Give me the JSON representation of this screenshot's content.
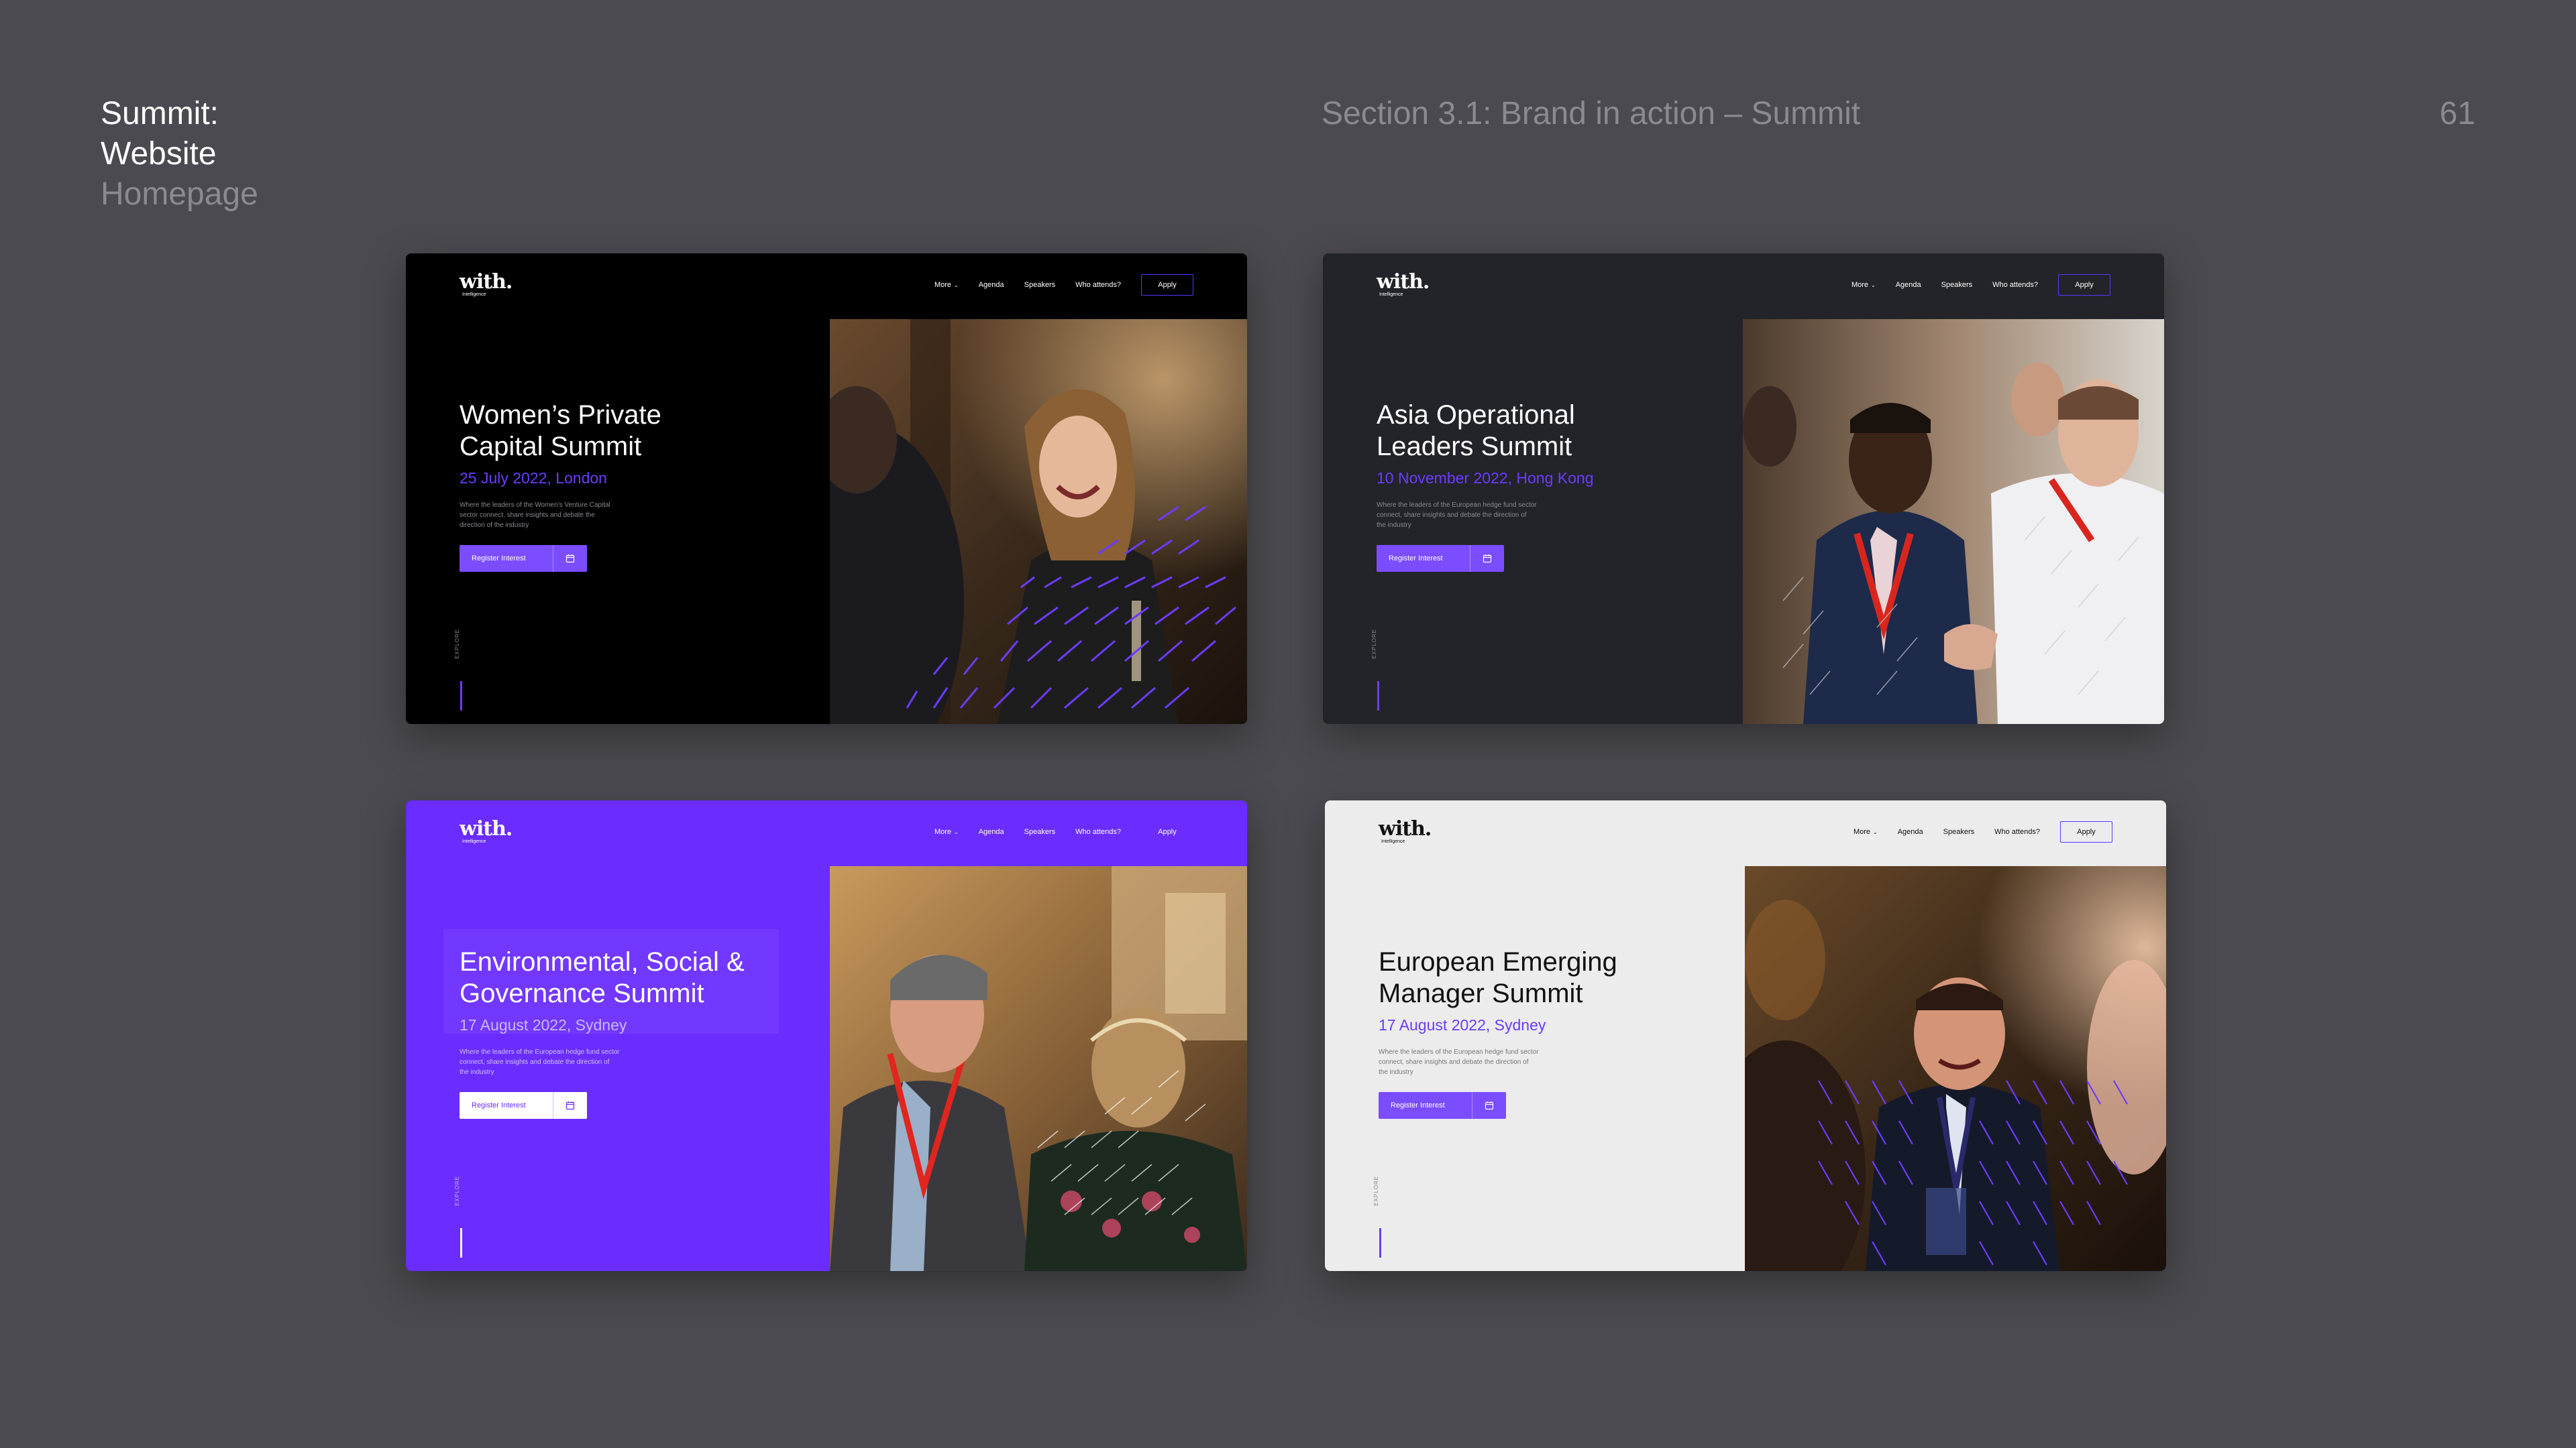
{
  "slide": {
    "meta": [
      "Summit:",
      "Website",
      "Homepage"
    ],
    "section_title": "Section 3.1: Brand in action – Summit",
    "page_number": "61"
  },
  "common": {
    "logo_word": "with.",
    "logo_sub": "Intelligence",
    "nav": [
      "More",
      "Agenda",
      "Speakers",
      "Who attends?"
    ],
    "apply": "Apply",
    "register": "Register Interest",
    "explore": "EXPLORE"
  },
  "cards": [
    {
      "theme": "black",
      "title": "Women’s Private\nCapital Summit",
      "date": "25 July 2022, London",
      "description": "Where the leaders of the Women’s Venture Capital\nsector connect, share insights and debate the\ndirection of the industry"
    },
    {
      "theme": "dark",
      "title": "Asia Operational\nLeaders Summit",
      "date": "10 November 2022, Hong Kong",
      "description": "Where the leaders of the European hedge fund sector\nconnect, share insights and debate the direction of\nthe industry"
    },
    {
      "theme": "purple",
      "title": "Environmental, Social &\nGovernance Summit",
      "date": "17 August 2022, Sydney",
      "description": "Where the leaders of the European hedge fund sector\nconnect, share insights and debate the direction of\nthe industry"
    },
    {
      "theme": "light",
      "title": "European Emerging\nManager Summit",
      "date": "17 August 2022, Sydney",
      "description": "Where the leaders of the European hedge fund sector\nconnect, share insights and debate the direction of\nthe industry"
    }
  ],
  "colors": {
    "background": "#4a4a50",
    "brand_purple": "#6a2cff",
    "accent_purple": "#7b4dff",
    "muted_text": "#8a8a90"
  },
  "icons": {
    "nav_dropdown": "chevron-down-icon",
    "register": "calendar-icon"
  }
}
